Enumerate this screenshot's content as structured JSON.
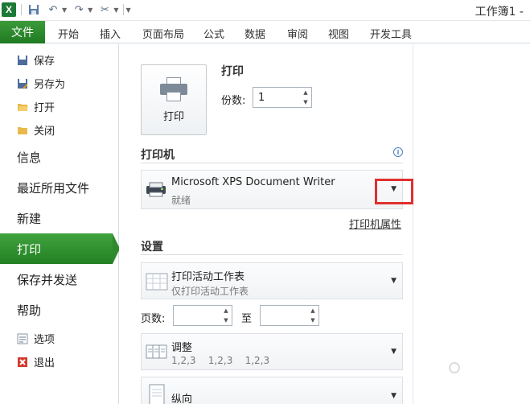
{
  "titlebar": {
    "app_icon": "excel-icon",
    "workbook_title": "工作簿1 -",
    "qat_icons": [
      "save-icon",
      "undo-icon",
      "redo-icon",
      "customize-tools-icon"
    ]
  },
  "ribbon": {
    "file_tab": "文件",
    "tabs": [
      "开始",
      "插入",
      "页面布局",
      "公式",
      "数据",
      "审阅",
      "视图",
      "开发工具"
    ]
  },
  "nav": {
    "small_top": [
      {
        "label": "保存",
        "icon": "save-icon"
      },
      {
        "label": "另存为",
        "icon": "save-as-icon"
      },
      {
        "label": "打开",
        "icon": "open-folder-icon"
      },
      {
        "label": "关闭",
        "icon": "close-folder-icon"
      }
    ],
    "big": [
      "信息",
      "最近所用文件",
      "新建",
      "打印",
      "保存并发送",
      "帮助"
    ],
    "active": "打印",
    "small_bottom": [
      {
        "label": "选项",
        "icon": "options-icon"
      },
      {
        "label": "退出",
        "icon": "exit-icon"
      }
    ]
  },
  "print": {
    "button_label": "打印",
    "section_title": "打印",
    "copies_label": "份数:",
    "copies_value": "1",
    "printer_section": "打印机",
    "printer_name": "Microsoft XPS Document Writer",
    "printer_status": "就绪",
    "printer_properties": "打印机属性",
    "settings_section": "设置",
    "scope_title": "打印活动工作表",
    "scope_subtitle": "仅打印活动工作表",
    "pages_label": "页数:",
    "pages_from": "",
    "pages_to_label": "至",
    "pages_to": "",
    "collate_title": "调整",
    "collate_subtitle": "1,2,3    1,2,3    1,2,3",
    "orientation_title": "纵向"
  },
  "colors": {
    "accent_green": "#2e8a2d",
    "highlight_red": "#e0302e"
  }
}
